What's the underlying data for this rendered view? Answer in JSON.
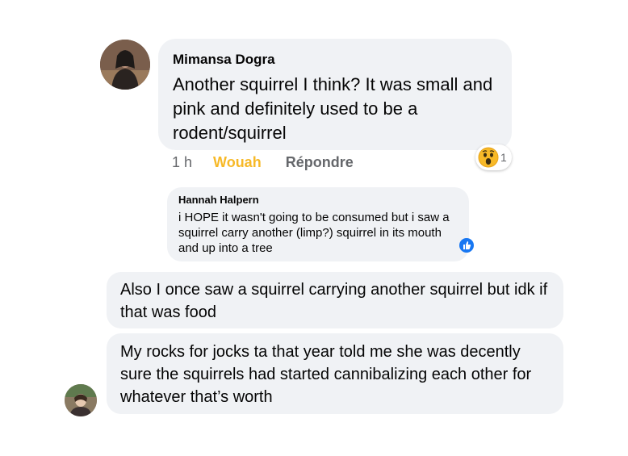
{
  "comment": {
    "author": "Mimansa Dogra",
    "text": "Another squirrel I think? It was small and pink and definitely used to be a rodent/squirrel",
    "time": "1 h",
    "reaction_label": "Wouah",
    "reply_label": "Répondre",
    "reaction_icon": "wow-emoji-icon",
    "reaction_count": "1"
  },
  "quoted_comment": {
    "author": "Hannah Halpern",
    "text": "i HOPE it wasn't going to be consumed but i saw a squirrel carry another (limp?) squirrel in its mouth and up into a tree",
    "reaction_icon": "like-icon"
  },
  "messages": [
    {
      "text": "Also I once saw a squirrel carrying another squirrel but idk if that was food"
    },
    {
      "text": "My rocks for jocks ta that year told me she was decently sure the squirrels had started cannibalizing each other for whatever that’s worth"
    }
  ],
  "colors": {
    "bubble": "#f0f2f5",
    "reaction_yellow": "#f7b928",
    "meta_gray": "#65676b",
    "like_blue": "#1877f2"
  }
}
